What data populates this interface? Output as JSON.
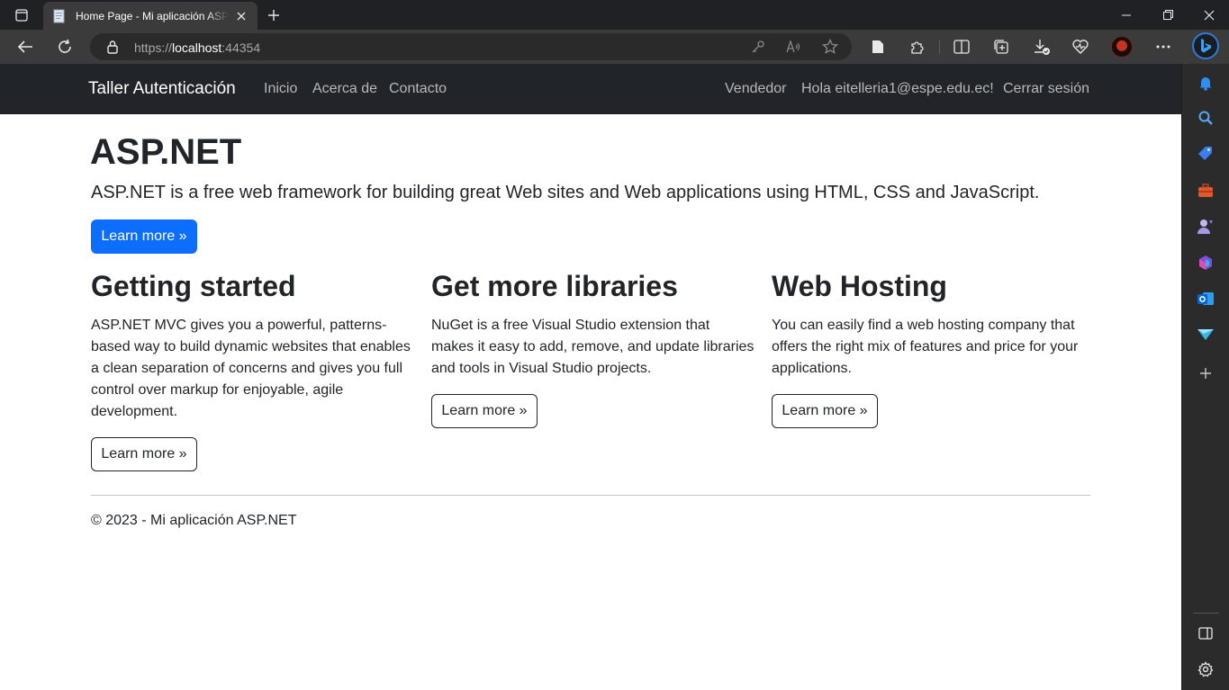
{
  "browser": {
    "tab_title": "Home Page - Mi aplicación ASP.NET",
    "url_prefix": "https://",
    "url_host": "localhost",
    "url_suffix": ":44354"
  },
  "navbar": {
    "brand": "Taller Autenticación",
    "links": [
      "Inicio",
      "Acerca de",
      "Contacto"
    ],
    "right_links": [
      "Vendedor",
      "Hola eitelleria1@espe.edu.ec!",
      "Cerrar sesión"
    ]
  },
  "jumbotron": {
    "title": "ASP.NET",
    "lead": "ASP.NET is a free web framework for building great Web sites and Web applications using HTML, CSS and JavaScript.",
    "button": "Learn more »"
  },
  "columns": [
    {
      "title": "Getting started",
      "text": "ASP.NET MVC gives you a powerful, patterns-based way to build dynamic websites that enables a clean separation of concerns and gives you full control over markup for enjoyable, agile development.",
      "button": "Learn more »"
    },
    {
      "title": "Get more libraries",
      "text": "NuGet is a free Visual Studio extension that makes it easy to add, remove, and update libraries and tools in Visual Studio projects.",
      "button": "Learn more »"
    },
    {
      "title": "Web Hosting",
      "text": "You can easily find a web hosting company that offers the right mix of features and price for your applications.",
      "button": "Learn more »"
    }
  ],
  "footer": {
    "text": "© 2023 - Mi aplicación ASP.NET"
  },
  "colors": {
    "navbar_bg": "#212529",
    "primary": "#0d6efd",
    "browser_dark": "#202124"
  }
}
